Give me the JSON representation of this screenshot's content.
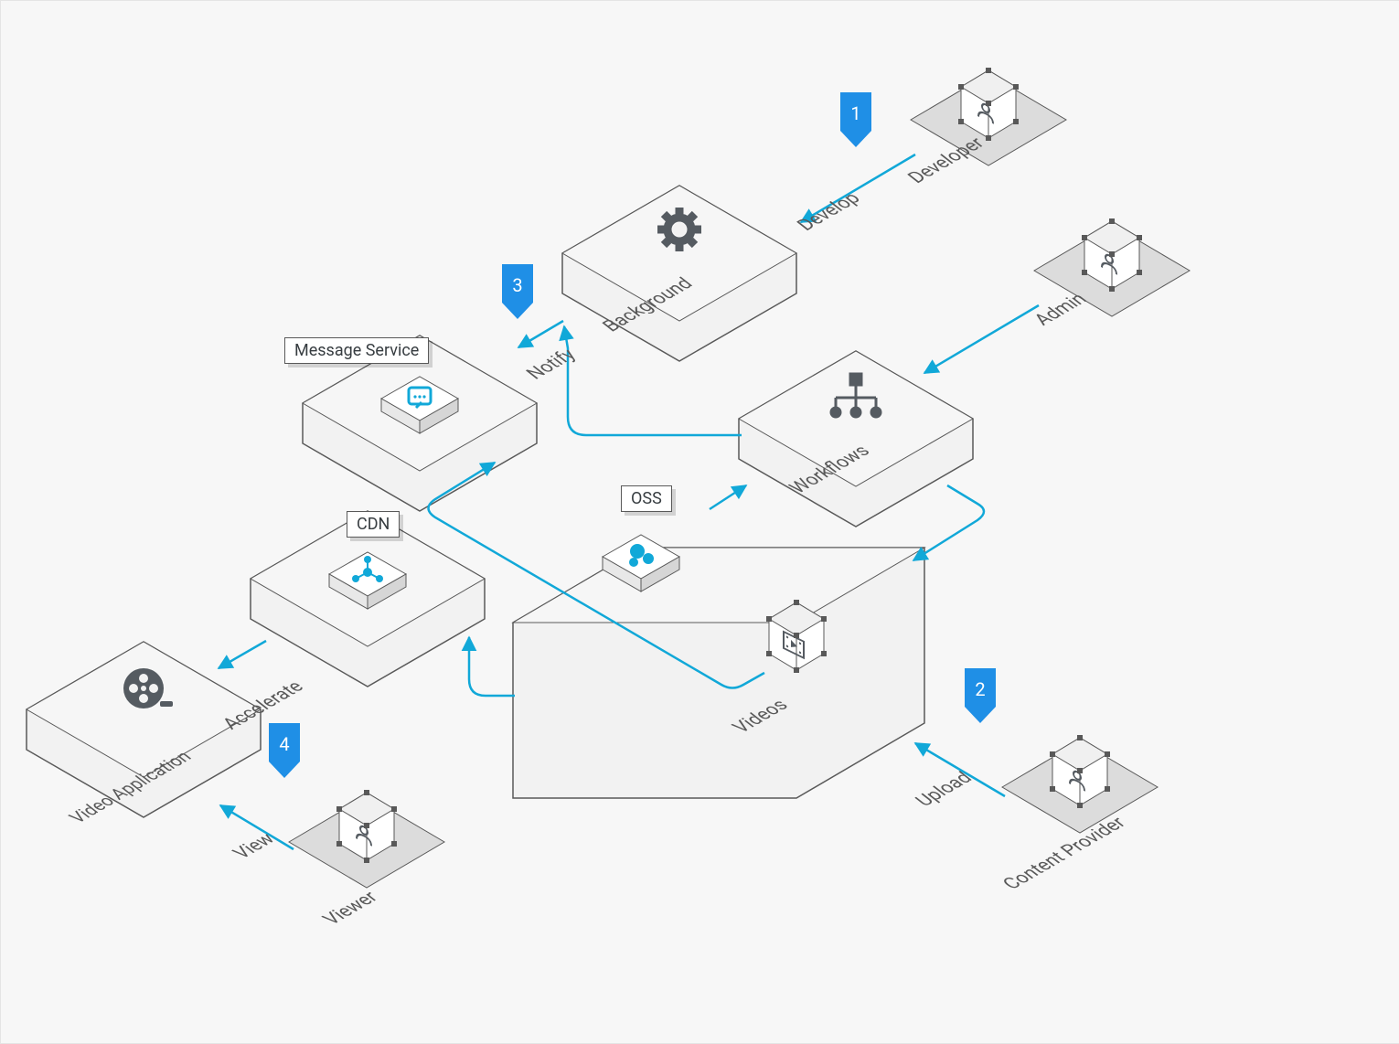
{
  "actors": {
    "developer": "Developer",
    "admin": "Admin",
    "content_provider": "Content Provider",
    "viewer": "Viewer"
  },
  "nodes": {
    "background": "Background",
    "workflows": "Workflows",
    "message_service": "Message Service",
    "cdn": "CDN",
    "oss": "OSS",
    "videos": "Videos",
    "video_application": "Video Application"
  },
  "edges": {
    "develop": "Develop",
    "notify": "Notify",
    "accelerate": "Accelerate",
    "view": "View",
    "upload": "Upload"
  },
  "steps": {
    "s1": "1",
    "s2": "2",
    "s3": "3",
    "s4": "4"
  },
  "colors": {
    "accent": "#11a8d8",
    "step_fill": "#1f8fe6",
    "hex_fill": "#f2f2f2",
    "hex_stroke": "#595959",
    "icon_dark": "#555b61"
  }
}
